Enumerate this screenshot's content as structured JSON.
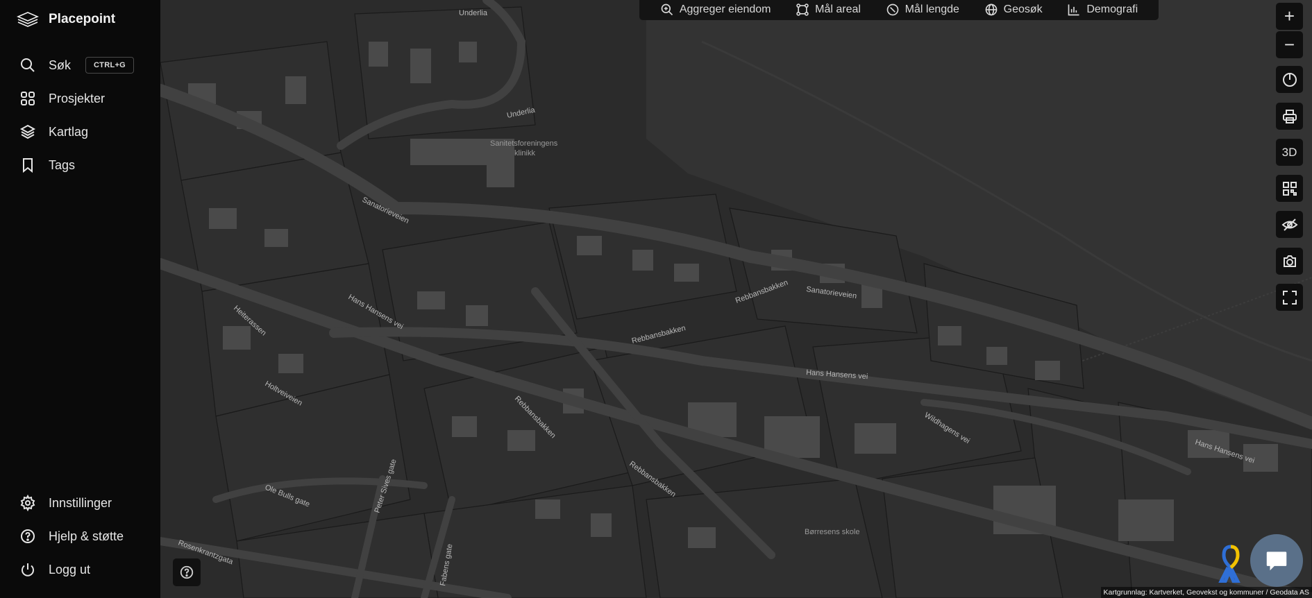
{
  "app": {
    "name": "Placepoint"
  },
  "sidebar": {
    "items": [
      {
        "label": "Søk",
        "shortcut": "CTRL+G",
        "icon": "search-icon"
      },
      {
        "label": "Prosjekter",
        "icon": "grid-icon"
      },
      {
        "label": "Kartlag",
        "icon": "layers-icon"
      },
      {
        "label": "Tags",
        "icon": "bookmark-icon"
      }
    ],
    "bottom_items": [
      {
        "label": "Innstillinger",
        "icon": "gear-icon"
      },
      {
        "label": "Hjelp & støtte",
        "icon": "help-icon"
      },
      {
        "label": "Logg ut",
        "icon": "power-icon"
      }
    ]
  },
  "toolbar": {
    "items": [
      {
        "label": "Aggreger eiendom",
        "icon": "aggregate-icon"
      },
      {
        "label": "Mål areal",
        "icon": "measure-area-icon"
      },
      {
        "label": "Mål lengde",
        "icon": "measure-length-icon"
      },
      {
        "label": "Geosøk",
        "icon": "globe-icon"
      },
      {
        "label": "Demografi",
        "icon": "bar-chart-icon"
      }
    ]
  },
  "controls": {
    "zoom_in": "+",
    "zoom_out": "−",
    "three_d": "3D"
  },
  "map": {
    "streets": [
      "Underlia",
      "Underlia",
      "Sanatorieveien",
      "Sanatorieveien",
      "Hans Hansens vei",
      "Hans Hansens vei",
      "Hans Hansens vei",
      "Heiterassen",
      "Rebbansbakken",
      "Rebbansbakken",
      "Rebbansbakken",
      "Rebbansbakken",
      "Holtveiveien",
      "Wildhagens vei",
      "Ole Bulls gate",
      "Peter Sives gate",
      "Rosenkrantzgata",
      "Fabens gate"
    ],
    "pois": [
      "Sanitetsforeningens",
      "klinikk",
      "Børresens skole"
    ],
    "attribution": "Kartgrunnlag: Kartverket, Geovekst og kommuner / Geodata AS"
  },
  "colors": {
    "sidebar_bg": "#0a0a0a",
    "map_bg": "#2b2b2b",
    "road": "#3f3f3f",
    "building": "#4a4a4a",
    "chat_accent": "#5a7089"
  }
}
